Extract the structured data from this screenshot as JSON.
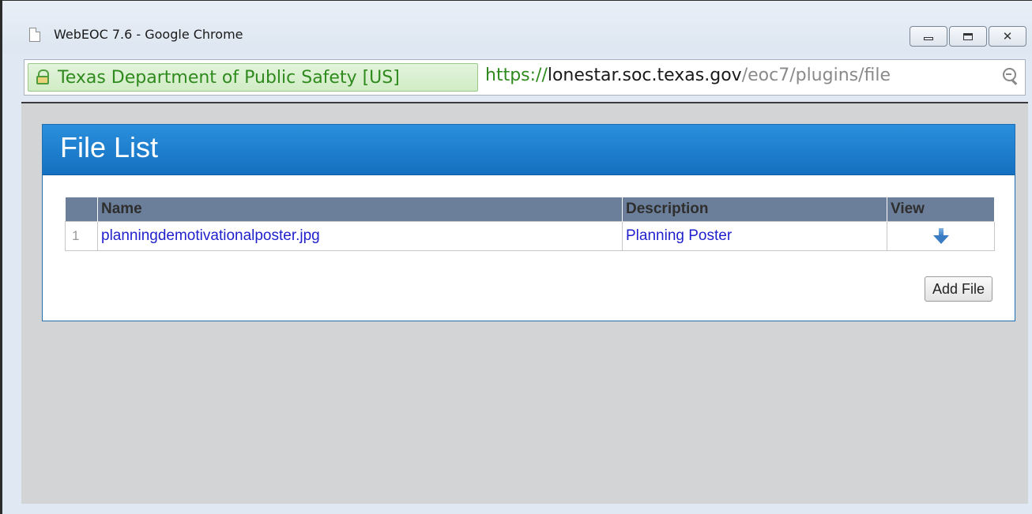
{
  "window": {
    "title": "WebEOC 7.6 - Google Chrome",
    "controls": {
      "minimize": "minimize",
      "maximize": "maximize",
      "close": "✕"
    }
  },
  "addressbar": {
    "security_label": "Texas Department of Public Safety [US]",
    "url_scheme": "https://",
    "url_host": "lonestar.soc.texas.gov",
    "url_path": "/eoc7/plugins/file"
  },
  "panel": {
    "title": "File List",
    "table": {
      "columns": [
        "Name",
        "Description",
        "View"
      ],
      "rows": [
        {
          "index": "1",
          "name": "planningdemotivationalposter.jpg",
          "description": "Planning Poster",
          "view_icon": "arrow-down-icon"
        }
      ]
    },
    "add_button_label": "Add File"
  },
  "colors": {
    "header_blue": "#1a7fd0",
    "link_blue": "#1f1fcc",
    "secure_green": "#2f8a1e",
    "table_header": "#6c7f9a"
  }
}
